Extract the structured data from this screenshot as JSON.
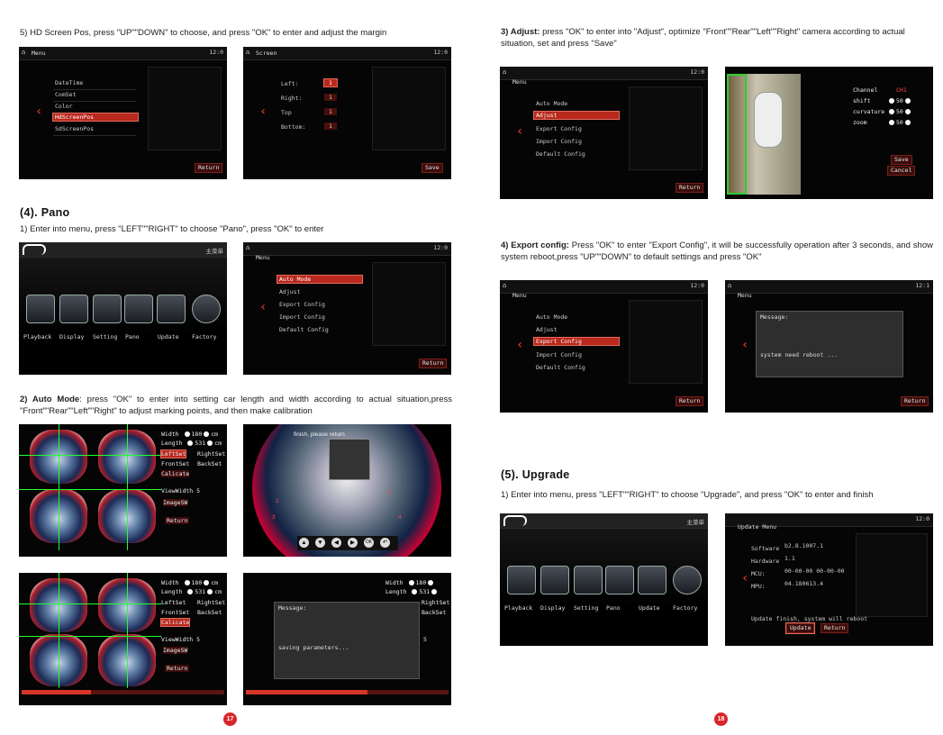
{
  "left": {
    "step5": "5) HD Screen Pos, press \"UP\"\"DOWN\" to choose, and press \"OK\" to enter and adjust the margin",
    "menu1": {
      "title": "Menu",
      "time": "12:0",
      "items": [
        "DateTime",
        "ComSet",
        "Color",
        "HdScreenPos",
        "SdScreenPos"
      ],
      "return": "Return"
    },
    "screen1": {
      "title": "Screen",
      "time": "12:0",
      "rows": [
        {
          "k": "Left:",
          "v": "1"
        },
        {
          "k": "Right:",
          "v": "1"
        },
        {
          "k": "Top",
          "v": "1"
        },
        {
          "k": "Bottom:",
          "v": "1"
        }
      ],
      "save": "Save"
    },
    "pano_heading": "(4). Pano",
    "pano_step1": "1) Enter into menu, press \"LEFT\"\"RIGHT\" to choose \"Pano\", press \"OK\" to enter",
    "mainmenu": {
      "label": "主菜单",
      "icons": [
        "Playback",
        "Display",
        "Setting",
        "Pano",
        "Update",
        "Factory"
      ]
    },
    "panomenu": {
      "title": "Menu",
      "time": "12:0",
      "items": [
        "Auto Mode",
        "Adjust",
        "Export Config",
        "Import Config",
        "Default Config"
      ],
      "return": "Return"
    },
    "auto_bold": "2) Auto Mode",
    "auto_text": ": press \"OK\" to enter into setting car length and width according to actual situation,press \"Front\"\"Rear\"\"Left\"\"Right\" to adjust marking points, and then make calibration",
    "calib1": {
      "width_label": "Width",
      "width_val": "180",
      "length_label": "Length",
      "length_val": "531",
      "unit": "cm",
      "leftset": "LeftSet",
      "rightset": "RightSet",
      "frontset": "FrontSet",
      "backset": "BackSet",
      "calicate": "Calicate",
      "viewwidth": "ViewWidth",
      "viewwidth_val": "5",
      "imagesw": "ImageSW",
      "return": "Return"
    },
    "fisheye": {
      "caption": "finish, please return",
      "buttons": [
        "▲",
        "▼",
        "◀",
        "▶",
        "OK",
        "↶"
      ],
      "marks": [
        "1",
        "2",
        "3",
        "4"
      ]
    },
    "calib2": {
      "width_label": "Width",
      "width_val": "180",
      "length_label": "Length",
      "length_val": "531",
      "unit": "cm",
      "leftset": "LeftSet",
      "rightset": "RightSet",
      "frontset": "FrontSet",
      "backset": "BackSet",
      "calicate": "Calicate",
      "viewwidth": "ViewWidth",
      "viewwidth_val": "5",
      "imagesw": "ImageSW",
      "return": "Return",
      "progress": 0.34
    },
    "saving": {
      "width_label": "Width",
      "width_val": "180",
      "length_label": "Length",
      "length_val": "531",
      "rightset": "RightSet",
      "backset": "BackSet",
      "msg_title": "Message:",
      "msg_body": "saving parameters...",
      "val": "5",
      "progress": 0.6
    },
    "page": "17"
  },
  "right": {
    "adjust_bold": "3) Adjust:",
    "adjust_text": " press \"OK\" to enter into \"Adjust\", optimize \"Front\"\"Rear\"\"Left\"\"Right\" camera according to actual situation, set and press \"Save\"",
    "adjmenu": {
      "title": "Menu",
      "time": "12:0",
      "items": [
        "Auto Mode",
        "Adjust",
        "Export Config",
        "Import Config",
        "Default Config"
      ],
      "return": "Return"
    },
    "adjview": {
      "channel_label": "Channel",
      "channel_val": "CH1",
      "shift_label": "shift",
      "shift_val": "50",
      "curvature_label": "curvature",
      "curvature_val": "50",
      "zoom_label": "zoom",
      "zoom_val": "50",
      "save": "Save",
      "cancel": "Cancel"
    },
    "export_bold": "4) Export config:",
    "export_text": " Press \"OK\" to enter \"Export Config\", it will be successfully operation after 3 seconds, and show system reboot,press \"UP\"\"DOWN\" to default settings and press \"OK\"",
    "expmenu": {
      "title": "Menu",
      "time": "12:0",
      "items": [
        "Auto Mode",
        "Adjust",
        "Export Config",
        "Import Config",
        "Default Config"
      ],
      "return": "Return"
    },
    "expmsg": {
      "title": "Menu",
      "time": "12:1",
      "msg_title": "Message:",
      "msg_body": "system need reboot ...",
      "return": "Return"
    },
    "upgrade_heading": "(5). Upgrade",
    "upgrade_step1": "1) Enter into menu, press \"LEFT\"\"RIGHT\" to choose \"Upgrade\", and press \"OK\" to enter and finish",
    "mainmenu": {
      "label": "主菜单",
      "icons": [
        "Playback",
        "Display",
        "Setting",
        "Pano",
        "Update",
        "Factory"
      ]
    },
    "update": {
      "title": "Update Menu",
      "time": "12:0",
      "software_label": "Software",
      "software_val": "b2.8.1007.1",
      "hardware_label": "Hardware",
      "hardware_val": "1.1",
      "mcu_label": "MCU:",
      "mcu_val": "00-00-00 00-00-00",
      "mpu_label": "MPU:",
      "mpu_val": "04.180613.4",
      "status": "Update finish, system will reboot",
      "update_btn": "Update",
      "return_btn": "Return"
    },
    "page": "18"
  }
}
